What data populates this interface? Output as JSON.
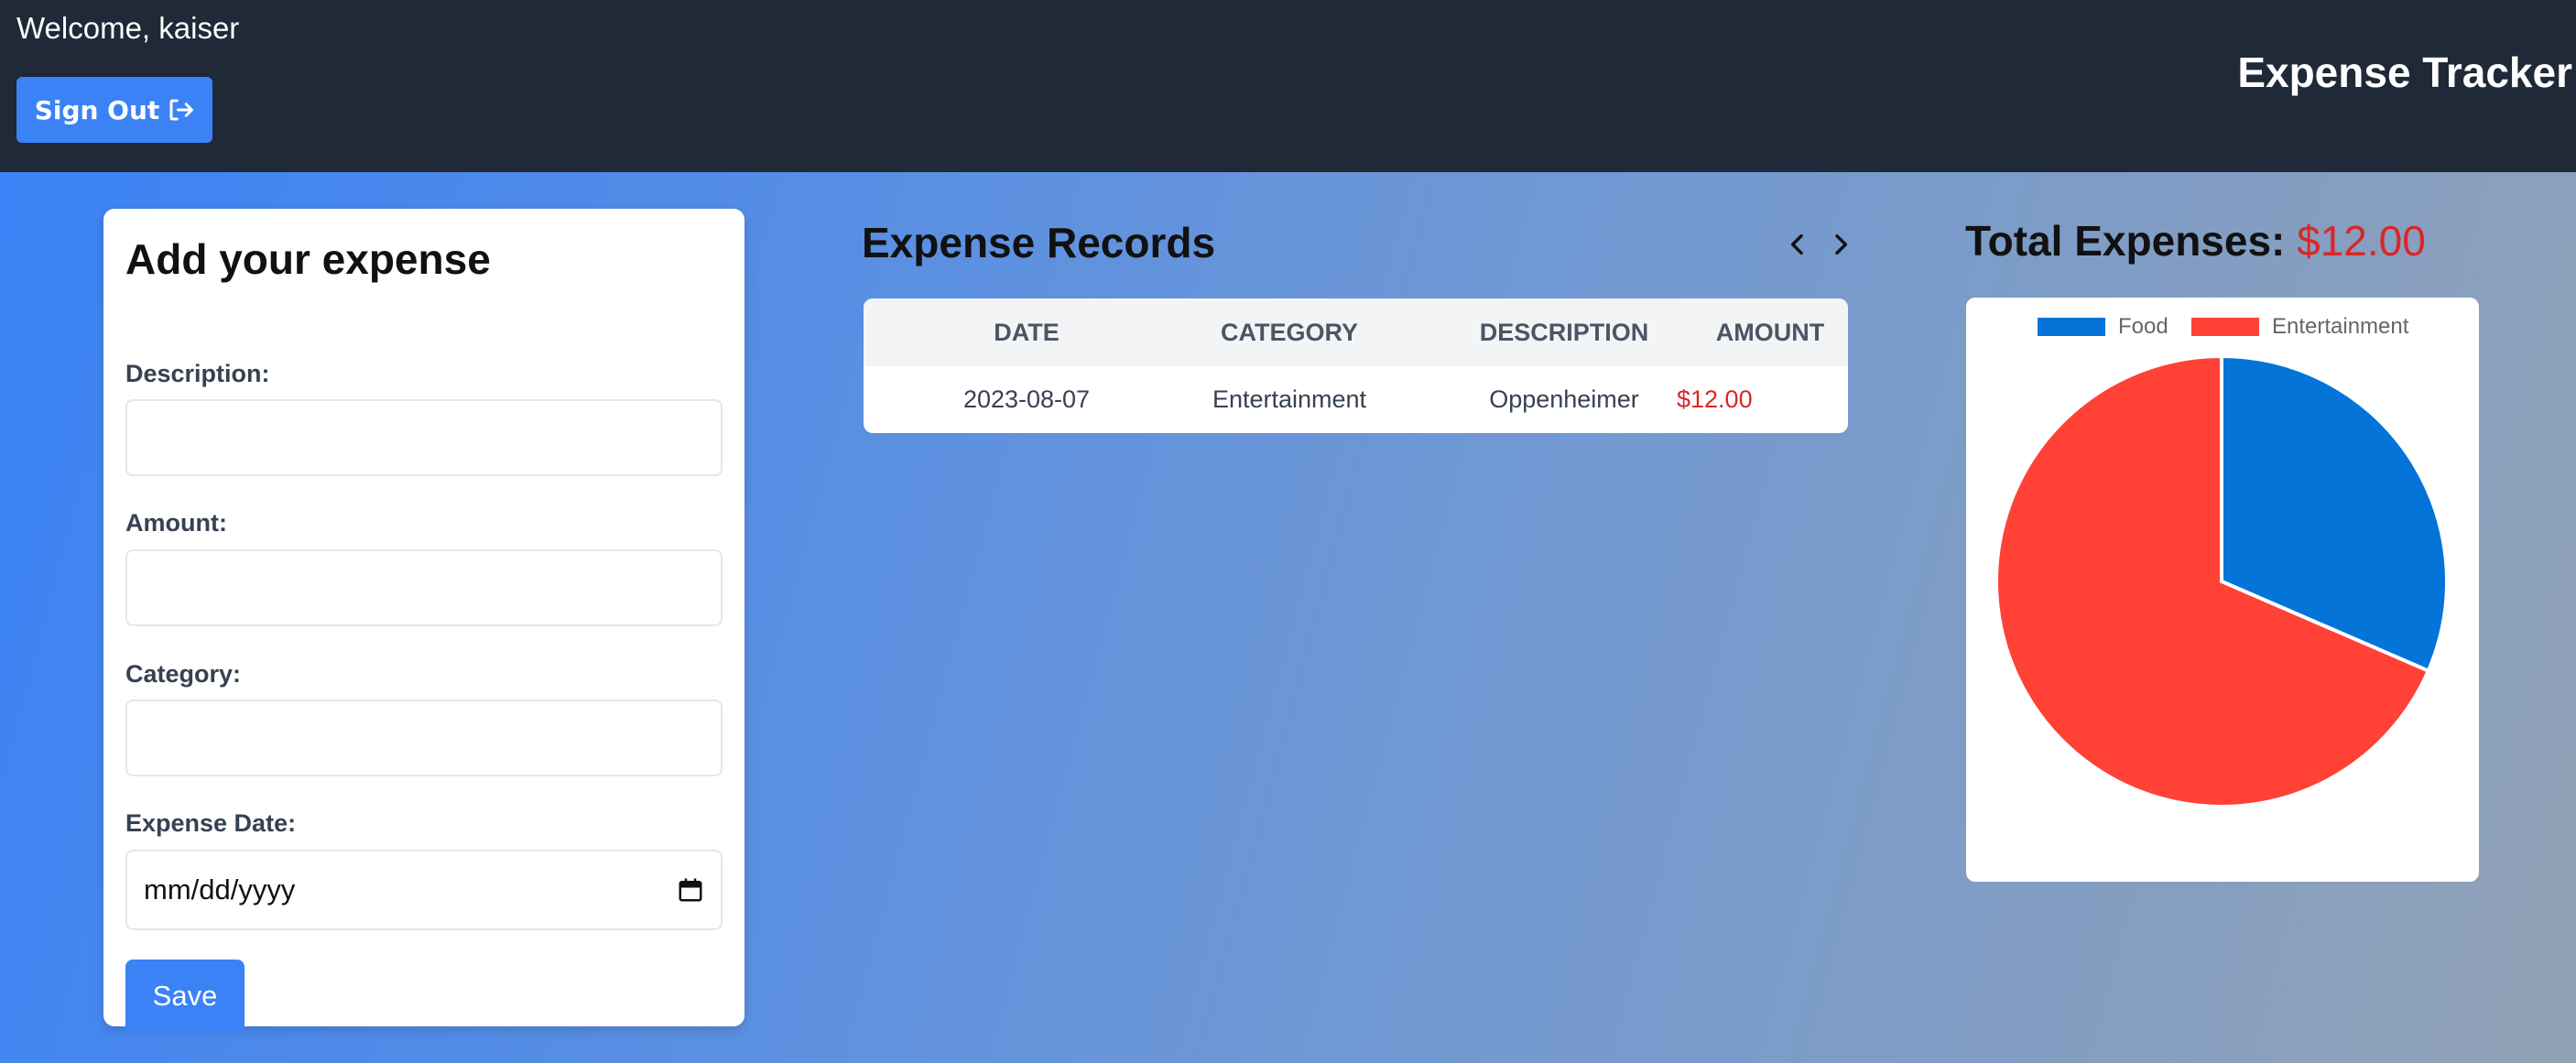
{
  "header": {
    "welcome": "Welcome, kaiser",
    "sign_out_label": "Sign Out",
    "sign_out_icon": "sign-out-icon",
    "app_title": "Expense Tracker"
  },
  "form": {
    "heading": "Add your expense",
    "description_label": "Description:",
    "description_value": "",
    "amount_label": "Amount:",
    "amount_value": "",
    "category_label": "Category:",
    "category_value": "",
    "date_label": "Expense Date:",
    "date_placeholder": "mm/dd/yyyy",
    "calendar_icon": "calendar-icon",
    "save_label": "Save"
  },
  "records": {
    "title": "Expense Records",
    "prev_icon": "chevron-left-icon",
    "next_icon": "chevron-right-icon",
    "columns": [
      "DATE",
      "CATEGORY",
      "DESCRIPTION",
      "AMOUNT"
    ],
    "rows": [
      {
        "date": "2023-08-07",
        "category": "Entertainment",
        "description": "Oppenheimer",
        "amount": "$12.00"
      }
    ]
  },
  "total": {
    "label": "Total Expenses:",
    "amount": "$12.00"
  },
  "colors": {
    "header_bg": "#1f2937",
    "accent": "#3b82f6",
    "amount_red": "#dc2626",
    "food": "#0474d9",
    "entertainment": "#ff4136"
  },
  "chart_data": {
    "type": "pie",
    "labels": [
      "Food",
      "Entertainment"
    ],
    "values": [
      31.5,
      68.5
    ],
    "colors": [
      "#0474d9",
      "#ff4136"
    ],
    "legend_position": "top"
  }
}
